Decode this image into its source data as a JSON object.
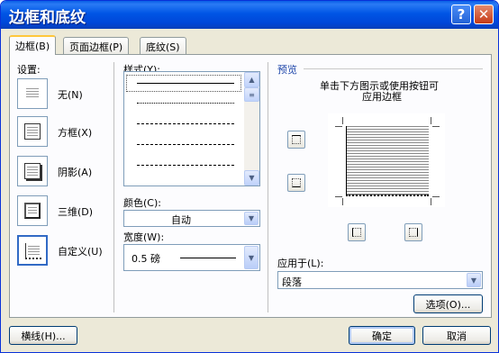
{
  "window": {
    "title": "边框和底纹"
  },
  "titlebar": {
    "help": "?",
    "close": "✕"
  },
  "tabs": [
    {
      "label": "边框(B)",
      "active": true
    },
    {
      "label": "页面边框(P)",
      "active": false
    },
    {
      "label": "底纹(S)",
      "active": false
    }
  ],
  "settings": {
    "label": "设置:",
    "items": [
      {
        "label": "无(N)",
        "icon": "border-none-icon"
      },
      {
        "label": "方框(X)",
        "icon": "border-box-icon"
      },
      {
        "label": "阴影(A)",
        "icon": "border-shadow-icon"
      },
      {
        "label": "三维(D)",
        "icon": "border-3d-icon"
      },
      {
        "label": "自定义(U)",
        "icon": "border-custom-icon",
        "selected": true
      }
    ]
  },
  "style": {
    "label": "样式(Y):",
    "options": [
      "solid",
      "dotted",
      "dashed-short",
      "dashed",
      "dash-dot"
    ]
  },
  "color": {
    "label": "颜色(C):",
    "value": "自动"
  },
  "width": {
    "label": "宽度(W):",
    "value": "0.5 磅"
  },
  "preview": {
    "label": "预览",
    "hint_line1": "单击下方图示或使用按钮可",
    "hint_line2": "应用边框"
  },
  "apply_to": {
    "label": "应用于(L):",
    "value": "段落"
  },
  "buttons": {
    "options": "选项(O)...",
    "horizontal_line": "横线(H)...",
    "ok": "确定",
    "cancel": "取消"
  },
  "colors": {
    "title_bar": "#0055E5",
    "dialog_bg": "#ECE9D8",
    "accent": "#316AC5",
    "tab_highlight": "#FFC73C"
  }
}
